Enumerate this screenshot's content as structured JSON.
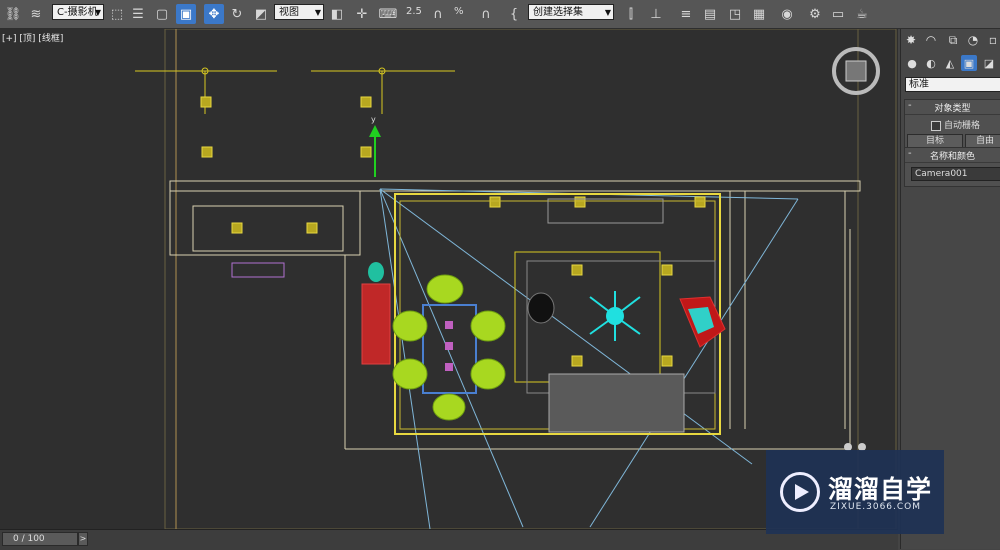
{
  "toolbar": {
    "selection_filter": "C-摄影机",
    "reference_coord": "视图",
    "snap_angle": "2.5",
    "percent_snap": "%",
    "named_selection": "创建选择集"
  },
  "viewport": {
    "label": "[+] [顶] [线框]"
  },
  "command_panel": {
    "type_dropdown": "标准",
    "object_type": {
      "title": "对象类型",
      "autogrid_label": "自动栅格",
      "buttons": [
        "目标",
        "自由"
      ]
    },
    "name_color": {
      "title": "名称和颜色",
      "name_value": "Camera001"
    }
  },
  "timeline": {
    "frame_counter": "0 / 100"
  },
  "watermark": {
    "title": "溜溜自学",
    "subtitle": "ZIXUE.3066.COM"
  },
  "colors": {
    "viewport_bg": "#2f2f2f",
    "ui_bg": "#565656",
    "wall_line": "#e8e0c0",
    "light_yellow": "#d8c820",
    "camera_blue": "#4a9fd0",
    "accent_blue": "#3b78c8"
  }
}
